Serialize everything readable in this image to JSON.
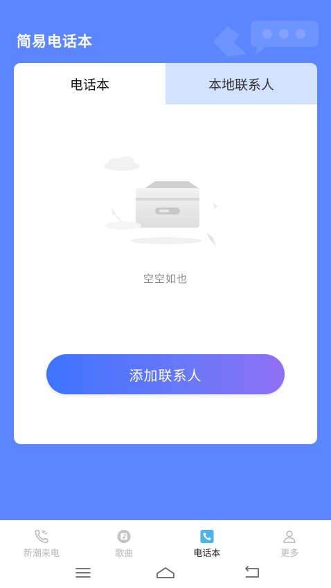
{
  "header": {
    "title": "简易电话本"
  },
  "tabs": [
    {
      "label": "电话本",
      "active": true
    },
    {
      "label": "本地联系人",
      "active": false
    }
  ],
  "empty_state": {
    "message": "空空如也"
  },
  "add_button": {
    "label": "添加联系人"
  },
  "bottom_nav": [
    {
      "label": "新潮来电",
      "icon": "phone-ring-icon",
      "active": false
    },
    {
      "label": "歌曲",
      "icon": "music-icon",
      "active": false
    },
    {
      "label": "电话本",
      "icon": "phone-book-icon",
      "active": true
    },
    {
      "label": "更多",
      "icon": "person-icon",
      "active": false
    }
  ],
  "system_nav": {
    "buttons": [
      "menu-icon",
      "home-icon",
      "back-icon"
    ]
  },
  "colors": {
    "background": "#5b86ff",
    "tab_inactive": "#d3e2ff",
    "button_gradient_start": "#3f73ff",
    "button_gradient_end": "#8f6ff5",
    "nav_active_icon": "#4fb3e8"
  }
}
